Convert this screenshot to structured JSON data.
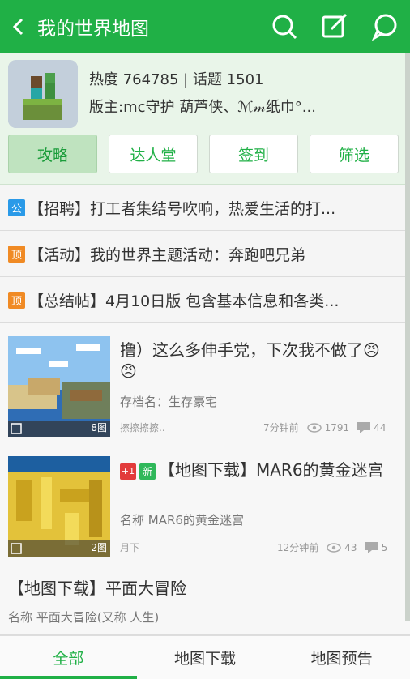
{
  "header": {
    "title": "我的世界地图",
    "back_icon": "chevron-left-icon",
    "icons": [
      "search-icon",
      "edit-icon",
      "chat-icon"
    ]
  },
  "forum": {
    "stats": "热度 764785 | 话题 1501",
    "moderators": "版主:mc守护 葫芦侠、ℳ𝓂纸巾°...",
    "tabs": [
      {
        "label": "攻略"
      },
      {
        "label": "达人堂"
      },
      {
        "label": "签到"
      },
      {
        "label": "筛选"
      }
    ]
  },
  "notices": [
    {
      "badge": "公",
      "badge_color": "#2a9ae8",
      "text": "【招聘】打工者集结号吹响，热爱生活的打..."
    },
    {
      "badge": "顶",
      "badge_color": "#f08a24",
      "text": "【活动】我的世界主题活动：奔跑吧兄弟"
    },
    {
      "badge": "顶",
      "badge_color": "#f08a24",
      "text": "【总结帖】4月10日版 包含基本信息和各类..."
    }
  ],
  "posts": [
    {
      "title": "撸）这么多伸手党，下次我不做了😠😠",
      "subtitle": "存档名：生存豪宅",
      "author": "擦擦擦擦..",
      "image_count": "8图",
      "time": "7分钟前",
      "views": "1791",
      "comments": "44"
    },
    {
      "tag_plus": "+1",
      "tag_new": "新",
      "title": "【地图下载】MAR6的黄金迷宫",
      "subtitle": "名称 MAR6的黄金迷宫",
      "author": "月下",
      "image_count": "2图",
      "time": "12分钟前",
      "views": "43",
      "comments": "5"
    },
    {
      "title": "【地图下载】平面大冒险",
      "subtitle": "名称  平面大冒险(又称 人生)"
    }
  ],
  "bottom_tabs": [
    {
      "label": "全部"
    },
    {
      "label": "地图下载"
    },
    {
      "label": "地图预告"
    }
  ],
  "colors": {
    "accent": "#20b046"
  }
}
